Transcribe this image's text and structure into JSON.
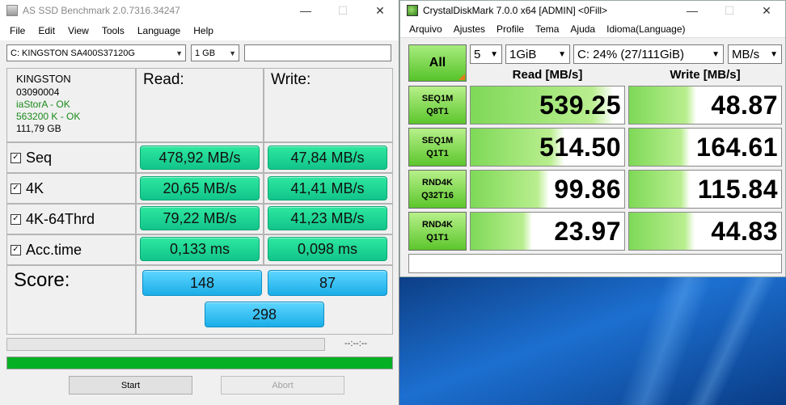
{
  "asssd": {
    "title": "AS SSD Benchmark 2.0.7316.34247",
    "window_controls": {
      "minimize": "—",
      "maximize": "☐",
      "close": "✕"
    },
    "menu": [
      "File",
      "Edit",
      "View",
      "Tools",
      "Language",
      "Help"
    ],
    "drive_select": "C: KINGSTON SA400S37120G",
    "size_select": "1 GB",
    "search_value": "",
    "info": {
      "model": "KINGSTON",
      "firmware": "03090004",
      "driver": "iaStorA - OK",
      "alignment": "563200 K - OK",
      "capacity": "111,79 GB"
    },
    "headers": {
      "read": "Read:",
      "write": "Write:"
    },
    "rows": [
      {
        "label": "Seq",
        "read": "478,92 MB/s",
        "write": "47,84 MB/s",
        "checked": true
      },
      {
        "label": "4K",
        "read": "20,65 MB/s",
        "write": "41,41 MB/s",
        "checked": true
      },
      {
        "label": "4K-64Thrd",
        "read": "79,22 MB/s",
        "write": "41,23 MB/s",
        "checked": true
      },
      {
        "label": "Acc.time",
        "read": "0,133 ms",
        "write": "0,098 ms",
        "checked": true
      }
    ],
    "score": {
      "label": "Score:",
      "read": "148",
      "write": "87",
      "total": "298"
    },
    "timer": "--:--:--",
    "progress_total_fraction": 1.0,
    "buttons": {
      "start": "Start",
      "abort": "Abort"
    },
    "colors": {
      "value_green": "#12c48a",
      "score_blue": "#1aaee8",
      "progress_green": "#06b025"
    }
  },
  "cdm": {
    "title": "CrystalDiskMark 7.0.0 x64 [ADMIN] <0Fill>",
    "window_controls": {
      "minimize": "—",
      "maximize": "☐",
      "close": "✕"
    },
    "menu": [
      "Arquivo",
      "Ajustes",
      "Profile",
      "Tema",
      "Ajuda",
      "Idioma(Language)"
    ],
    "all_button": "All",
    "count_select": "5",
    "size_select": "1GiB",
    "drive_select": "C: 24% (27/111GiB)",
    "unit_select": "MB/s",
    "headers": {
      "read": "Read [MB/s]",
      "write": "Write [MB/s]"
    },
    "tests": [
      {
        "line1": "SEQ1M",
        "line2": "Q8T1",
        "read": "539.25",
        "write": "48.87",
        "read_fill": 0.93,
        "write_fill": 0.44
      },
      {
        "line1": "SEQ1M",
        "line2": "Q1T1",
        "read": "514.50",
        "write": "164.61",
        "read_fill": 0.61,
        "write_fill": 0.4
      },
      {
        "line1": "RND4K",
        "line2": "Q32T16",
        "read": "99.86",
        "write": "115.84",
        "read_fill": 0.51,
        "write_fill": 0.4
      },
      {
        "line1": "RND4K",
        "line2": "Q1T1",
        "read": "23.97",
        "write": "44.83",
        "read_fill": 0.4,
        "write_fill": 0.43
      }
    ],
    "comment": "",
    "colors": {
      "label_green": "#5cc62c",
      "bar_green": "#7ed957"
    }
  }
}
